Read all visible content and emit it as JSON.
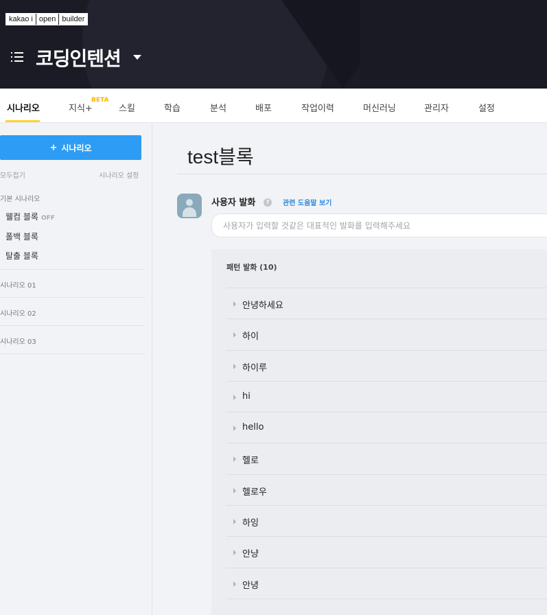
{
  "header": {
    "logo": [
      "kakao i",
      "open",
      "builder"
    ],
    "bot_name": "코딩인텐션"
  },
  "tabs": [
    {
      "label": "시나리오",
      "active": true
    },
    {
      "label": "지식+"
    },
    {
      "label": "스킬"
    },
    {
      "label": "학습"
    },
    {
      "label": "분석"
    },
    {
      "label": "배포"
    },
    {
      "label": "작업이력"
    },
    {
      "label": "머신러닝"
    },
    {
      "label": "관리자"
    },
    {
      "label": "설정"
    }
  ],
  "beta_badge": "BETA",
  "sidebar": {
    "add_button": "시나리오",
    "collapse_all": "모두접기",
    "scenario_settings": "시나리오 설정",
    "default_group": "기본 시나리오",
    "default_blocks": [
      {
        "label": "웰컴 블록",
        "tag": "OFF"
      },
      {
        "label": "폴백 블록"
      },
      {
        "label": "탈출 블록"
      }
    ],
    "scenarios": [
      "시나리오 01",
      "시나리오 02",
      "시나리오 03"
    ]
  },
  "main": {
    "block_title": "test블록",
    "utterance_label": "사용자 발화",
    "help_glyph": "?",
    "help_link": "관련 도움말 보기",
    "utterance_placeholder": "사용자가 입력할 것같은 대표적인 발화를 입력해주세요",
    "pattern_header": "패턴 발화 (10)",
    "patterns": [
      "안녕하세요",
      "하이",
      "하이루",
      "hi",
      "hello",
      "헬로",
      "헬로우",
      "하잉",
      "안냥",
      "안녕"
    ]
  },
  "colors": {
    "header_bg": "#1a1b25",
    "accent_blue": "#2d9cf4",
    "tab_underline": "#ffd42e",
    "beta": "#f5b800"
  },
  "icons": [
    "hamburger-menu-icon",
    "caret-down-icon",
    "plus-icon",
    "help-icon",
    "user-avatar-icon",
    "triangle-right-icon"
  ]
}
